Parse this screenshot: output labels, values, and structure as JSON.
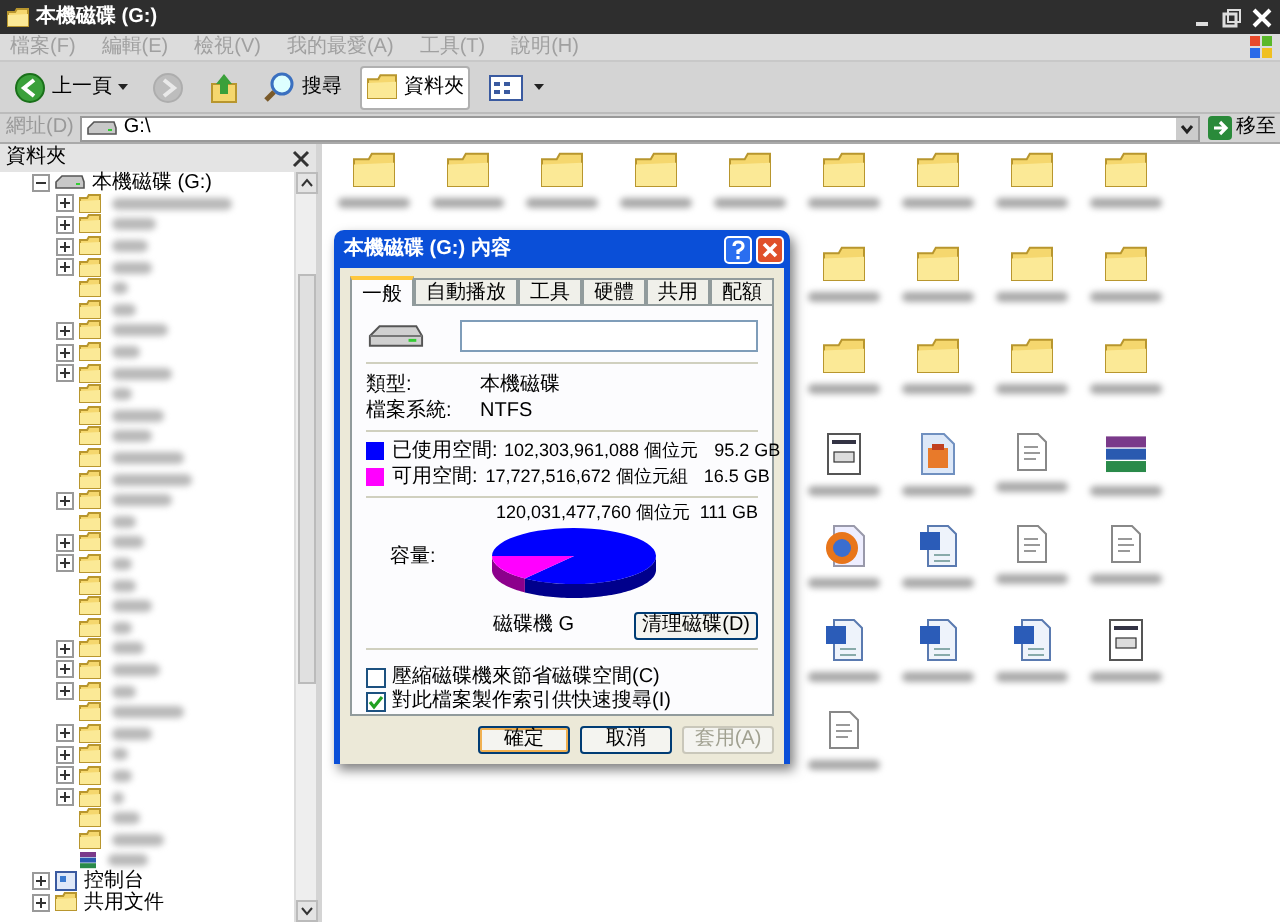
{
  "window": {
    "title": "本機磁碟 (G:)"
  },
  "menu": [
    "檔案(F)",
    "編輯(E)",
    "檢視(V)",
    "我的最愛(A)",
    "工具(T)",
    "說明(H)"
  ],
  "toolbar": [
    {
      "kind": "back",
      "label": "上一頁",
      "pressed": false,
      "disabled": false
    },
    {
      "kind": "forward",
      "pressed": false,
      "disabled": true
    },
    {
      "kind": "up",
      "pressed": false,
      "disabled": false
    },
    {
      "kind": "search",
      "label": "搜尋",
      "pressed": false,
      "disabled": false
    },
    {
      "kind": "folders",
      "label": "資料夾",
      "pressed": true,
      "disabled": false
    },
    {
      "kind": "views",
      "pressed": false,
      "disabled": false
    }
  ],
  "address_bar": {
    "label": "網址(D)",
    "value": "G:\\",
    "go_button": "移至"
  },
  "folder_pane": {
    "title": "資料夾",
    "tree": [
      {
        "label": "本機磁碟 (G:)",
        "kind": "drive",
        "expanded": true,
        "children": [
          {
            "kind": "folder",
            "expandable": true
          },
          {
            "kind": "folder",
            "expandable": true
          },
          {
            "kind": "folder",
            "expandable": true
          },
          {
            "kind": "folder",
            "expandable": true
          },
          {
            "kind": "folder",
            "expandable": false
          },
          {
            "kind": "folder",
            "expandable": false
          },
          {
            "kind": "folder",
            "expandable": true
          },
          {
            "kind": "folder",
            "expandable": true
          },
          {
            "kind": "folder",
            "expandable": true
          },
          {
            "kind": "folder",
            "expandable": false
          },
          {
            "kind": "folder",
            "expandable": false
          },
          {
            "kind": "folder",
            "expandable": false
          },
          {
            "kind": "folder",
            "expandable": false
          },
          {
            "kind": "folder",
            "expandable": false
          },
          {
            "kind": "folder",
            "expandable": true
          },
          {
            "kind": "folder",
            "expandable": false
          },
          {
            "kind": "folder",
            "expandable": true
          },
          {
            "kind": "folder",
            "expandable": true
          },
          {
            "kind": "folder",
            "expandable": false
          },
          {
            "kind": "folder",
            "expandable": false
          },
          {
            "kind": "folder",
            "expandable": false
          },
          {
            "kind": "folder",
            "expandable": true
          },
          {
            "kind": "folder",
            "expandable": true
          },
          {
            "kind": "folder",
            "expandable": true
          },
          {
            "kind": "folder",
            "expandable": false
          },
          {
            "kind": "folder",
            "expandable": true
          },
          {
            "kind": "folder",
            "expandable": true
          },
          {
            "kind": "folder",
            "expandable": true
          },
          {
            "kind": "folder",
            "expandable": true
          },
          {
            "kind": "folder",
            "expandable": false
          },
          {
            "kind": "folder",
            "expandable": false
          },
          {
            "kind": "archive",
            "expandable": false
          }
        ]
      },
      {
        "label": "控制台",
        "kind": "control_panel",
        "expanded": false
      },
      {
        "label": "共用文件",
        "kind": "folder",
        "expanded": false
      }
    ]
  },
  "content": {
    "top_row": [
      {
        "kind": "folder"
      },
      {
        "kind": "folder"
      },
      {
        "kind": "folder"
      },
      {
        "kind": "folder"
      },
      {
        "kind": "folder"
      },
      {
        "kind": "folder"
      },
      {
        "kind": "folder"
      },
      {
        "kind": "folder"
      },
      {
        "kind": "folder"
      }
    ],
    "items": [
      {
        "kind": "folder"
      },
      {
        "kind": "folder"
      },
      {
        "kind": "folder"
      },
      {
        "kind": "folder"
      },
      {
        "kind": "folder"
      },
      {
        "kind": "folder"
      },
      {
        "kind": "folder"
      },
      {
        "kind": "folder"
      },
      {
        "kind": "exe"
      },
      {
        "kind": "image"
      },
      {
        "kind": "text"
      },
      {
        "kind": "archive"
      },
      {
        "kind": "browser"
      },
      {
        "kind": "word"
      },
      {
        "kind": "text"
      },
      {
        "kind": "text"
      },
      {
        "kind": "word"
      },
      {
        "kind": "word"
      },
      {
        "kind": "word"
      },
      {
        "kind": "exe"
      },
      {
        "kind": "text"
      }
    ]
  },
  "dialog": {
    "title": "本機磁碟 (G:) 內容",
    "tabs": [
      {
        "label": "一般",
        "selected": true
      },
      {
        "label": "自動播放",
        "selected": false
      },
      {
        "label": "工具",
        "selected": false
      },
      {
        "label": "硬體",
        "selected": false
      },
      {
        "label": "共用",
        "selected": false
      },
      {
        "label": "配額",
        "selected": false
      }
    ],
    "type_label": "類型:",
    "type_value": "本機磁碟",
    "fs_label": "檔案系統:",
    "fs_value": "NTFS",
    "space": [
      {
        "label": "已使用空間:",
        "bytes": "102,303,961,088 個位元",
        "size": "95.2 GB",
        "color": "#0000ff"
      },
      {
        "label": "可用空間:",
        "bytes": "17,727,516,672 個位元組",
        "size": "16.5 GB",
        "color": "#ff00ff"
      }
    ],
    "capacity": {
      "label": "容量:",
      "bytes": "120,031,477,760 個位元",
      "size": "111 GB"
    },
    "drive_label": "磁碟機 G",
    "cleanup_button": "清理磁碟(D)",
    "options": [
      {
        "label": "壓縮磁碟機來節省磁碟空間(C)",
        "checked": false
      },
      {
        "label": "對此檔案製作索引供快速搜尋(I)",
        "checked": true
      }
    ],
    "buttons": [
      {
        "label": "確定",
        "kind": "default",
        "disabled": false
      },
      {
        "label": "取消",
        "kind": "normal",
        "disabled": false
      },
      {
        "label": "套用(A)",
        "kind": "normal",
        "disabled": true
      }
    ]
  }
}
